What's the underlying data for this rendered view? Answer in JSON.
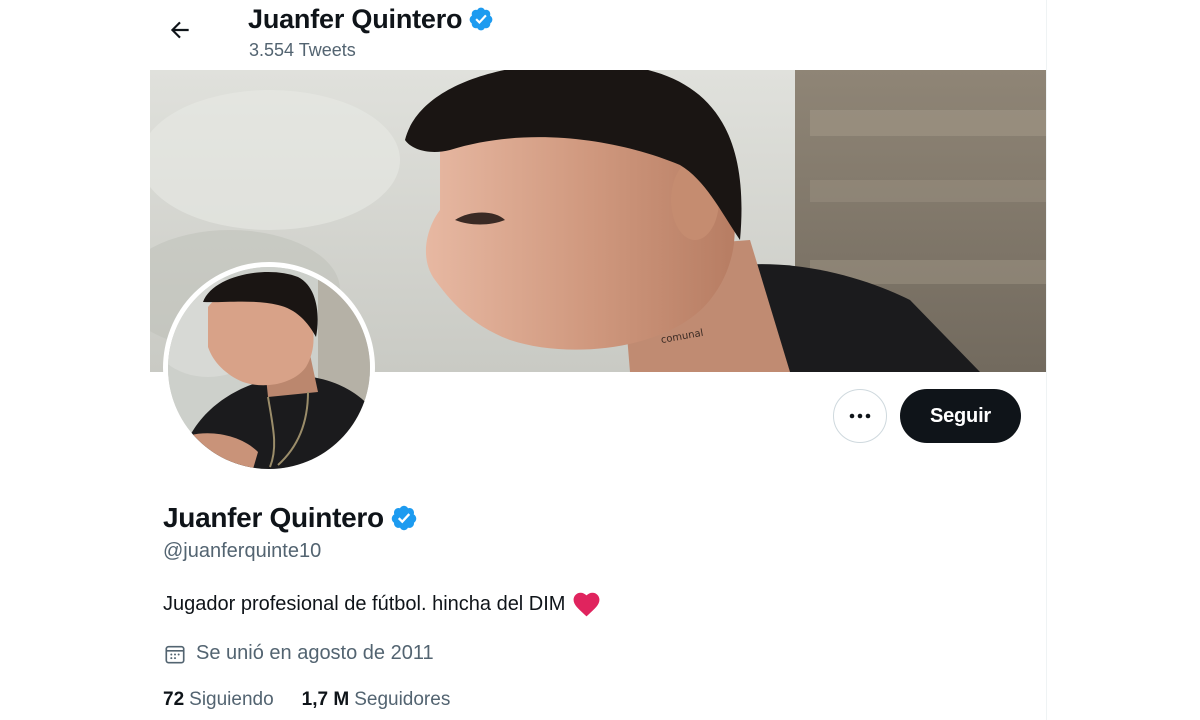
{
  "header": {
    "name": "Juanfer Quintero",
    "tweet_count": "3.554 Tweets"
  },
  "profile": {
    "name": "Juanfer Quintero",
    "handle": "@juanferquinte10",
    "bio": "Jugador profesional de fútbol. hincha del DIM",
    "joined": "Se unió en agosto de 2011",
    "following_count": "72",
    "following_label": "Siguiendo",
    "followers_count": "1,7 M",
    "followers_label": "Seguidores",
    "verified": true
  },
  "actions": {
    "follow_label": "Seguir",
    "more_icon": "more-dots-icon"
  },
  "colors": {
    "verified_badge": "#1d9bf0",
    "text_primary": "#0f1419",
    "text_secondary": "#536471",
    "heart": "#e0245e",
    "follow_button": "#0f1419"
  },
  "icons": {
    "back": "back-arrow-icon",
    "verified": "verified-badge-icon",
    "calendar": "calendar-icon",
    "heart": "heart-icon"
  }
}
